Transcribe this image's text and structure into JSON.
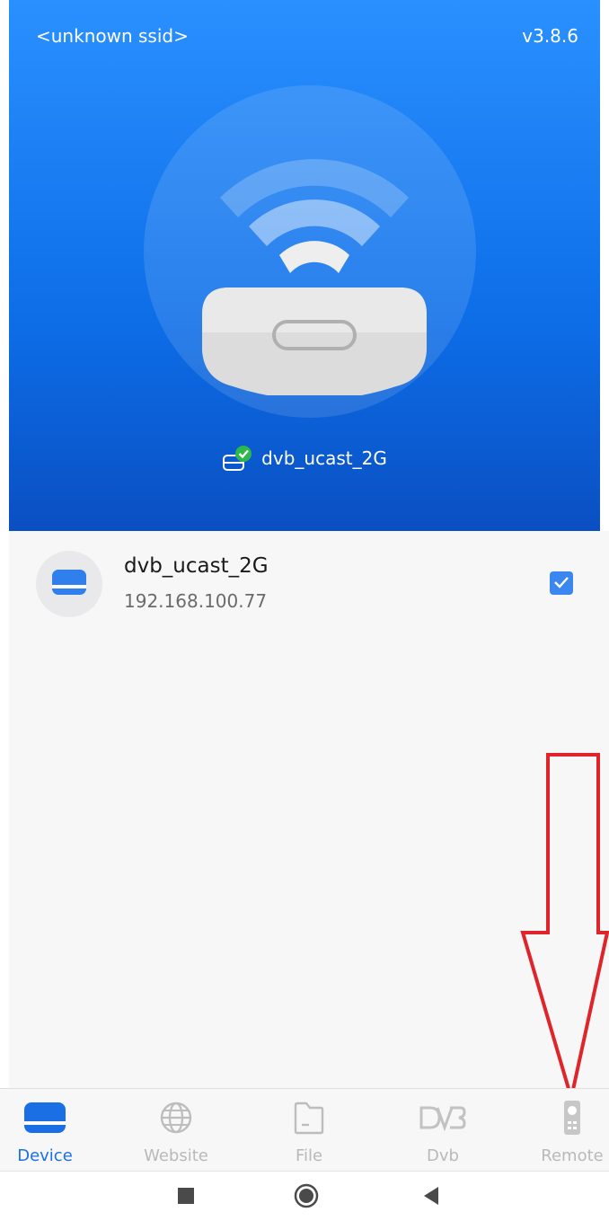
{
  "header": {
    "ssid": "<unknown ssid>",
    "version": "v3.8.6",
    "connected_device": "dvb_ucast_2G"
  },
  "devices": [
    {
      "name": "dvb_ucast_2G",
      "ip": "192.168.100.77",
      "checked": true
    }
  ],
  "tabs": [
    {
      "label": "Device",
      "icon": "device-icon",
      "active": true
    },
    {
      "label": "Website",
      "icon": "globe-icon",
      "active": false
    },
    {
      "label": "File",
      "icon": "folder-icon",
      "active": false
    },
    {
      "label": "Dvb",
      "icon": "dvb-icon",
      "active": false
    },
    {
      "label": "Remote",
      "icon": "remote-icon",
      "active": false
    }
  ],
  "colors": {
    "header_top": "#2a90ff",
    "header_bottom": "#0a4fc2",
    "accent": "#1b6fe4",
    "arrow": "#e0252a"
  }
}
